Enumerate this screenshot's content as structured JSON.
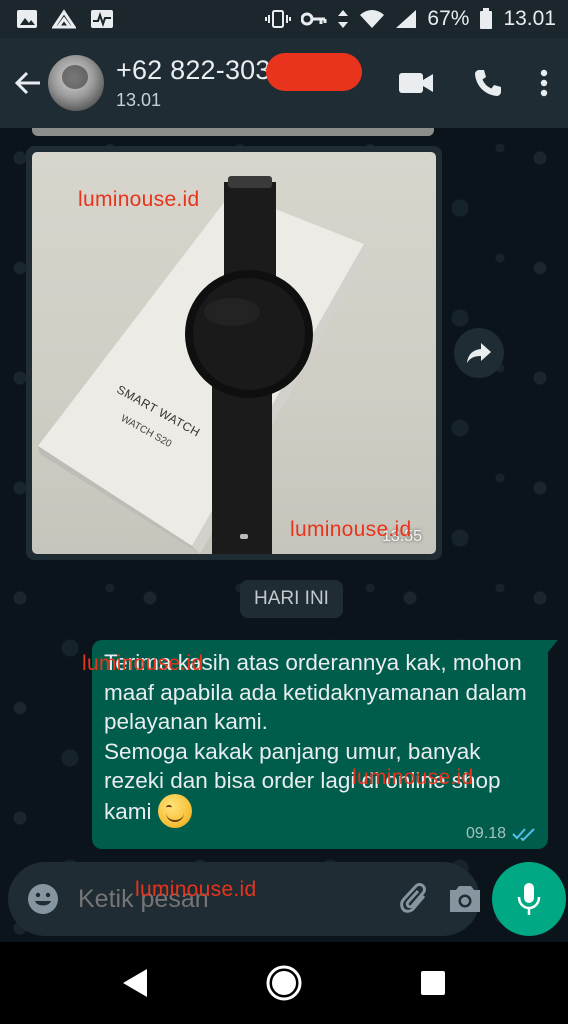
{
  "status_bar": {
    "battery": "67%",
    "time": "13.01",
    "left_icons": [
      "image-icon",
      "mountain-icon",
      "activity-icon"
    ],
    "right_icons": [
      "vibrate-icon",
      "vpn-key-icon",
      "data-arrows-icon",
      "wifi-icon",
      "signal-icon",
      "battery-icon"
    ]
  },
  "header": {
    "contact_name": "+62 822-303",
    "last_seen": "13.01",
    "redaction_color": "#e8341c",
    "actions": [
      "video-call-icon",
      "voice-call-icon",
      "more-options-icon"
    ]
  },
  "messages": {
    "image_message": {
      "box_text_1": "SMART WATCH",
      "box_text_2": "WATCH  S20",
      "time": "13.55"
    },
    "date_chip": "HARI INI",
    "outgoing": {
      "text": "Terima kasih atas orderannya kak, mohon maaf apabila ada ketidaknyamanan dalam pelayanan kami.\nSemoga kakak panjang umur, banyak rezeki dan bisa order lagi di online shop kami",
      "time": "09.18",
      "status": "read"
    }
  },
  "watermarks": {
    "text_1": "luminouse.id",
    "text_2": "luminouse.id",
    "text_3": "luminouse.id",
    "text_4": "luminouse.id",
    "text_5": "luminouse.id"
  },
  "composer": {
    "placeholder": "Ketik pesan"
  },
  "colors": {
    "header_bg": "#1f2c33",
    "outgoing_bubble": "#005c4b",
    "accent": "#00a884",
    "read_ticks": "#53bdeb",
    "watermark": "#e8341c"
  }
}
